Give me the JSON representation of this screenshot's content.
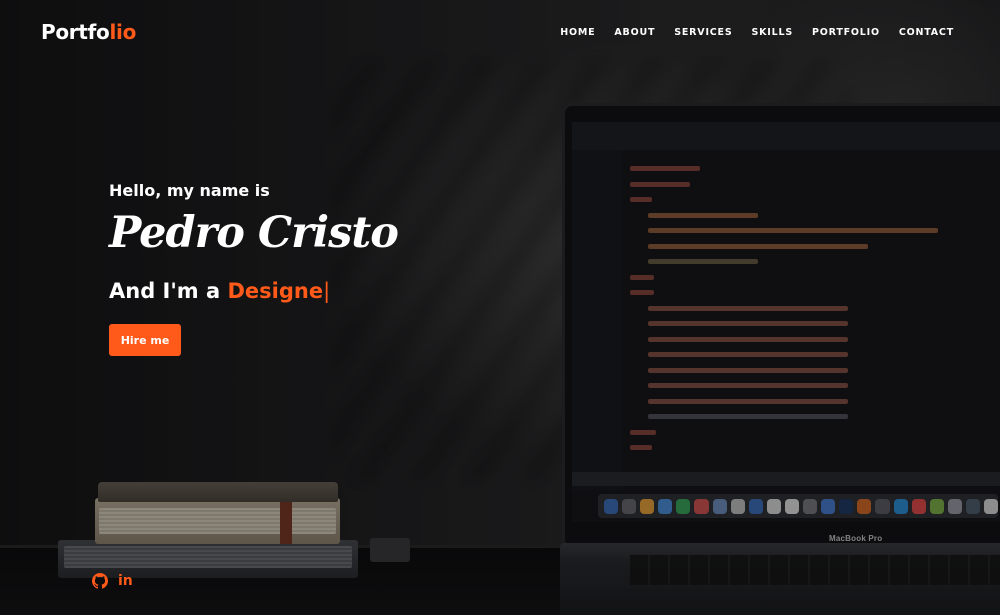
{
  "header": {
    "logo_main": "Portfo",
    "logo_accent": "lio",
    "nav": [
      {
        "label": "HOME"
      },
      {
        "label": "ABOUT"
      },
      {
        "label": "SERVICES"
      },
      {
        "label": "SKILLS"
      },
      {
        "label": "PORTFOLIO"
      },
      {
        "label": "CONTACT"
      }
    ]
  },
  "hero": {
    "greeting": "Hello, my name is",
    "name": "Pedro Cristo",
    "role_prefix": "And I'm a ",
    "role_typed": "Designe",
    "cursor": "|",
    "cta_label": "Hire me"
  },
  "background": {
    "laptop_brand": "MacBook Pro"
  },
  "social": [
    {
      "icon": "github-icon"
    },
    {
      "icon": "linkedin-icon",
      "glyph": "in"
    }
  ],
  "colors": {
    "accent": "#ff5a19",
    "text": "#ffffff",
    "background": "#1b1b1d"
  }
}
